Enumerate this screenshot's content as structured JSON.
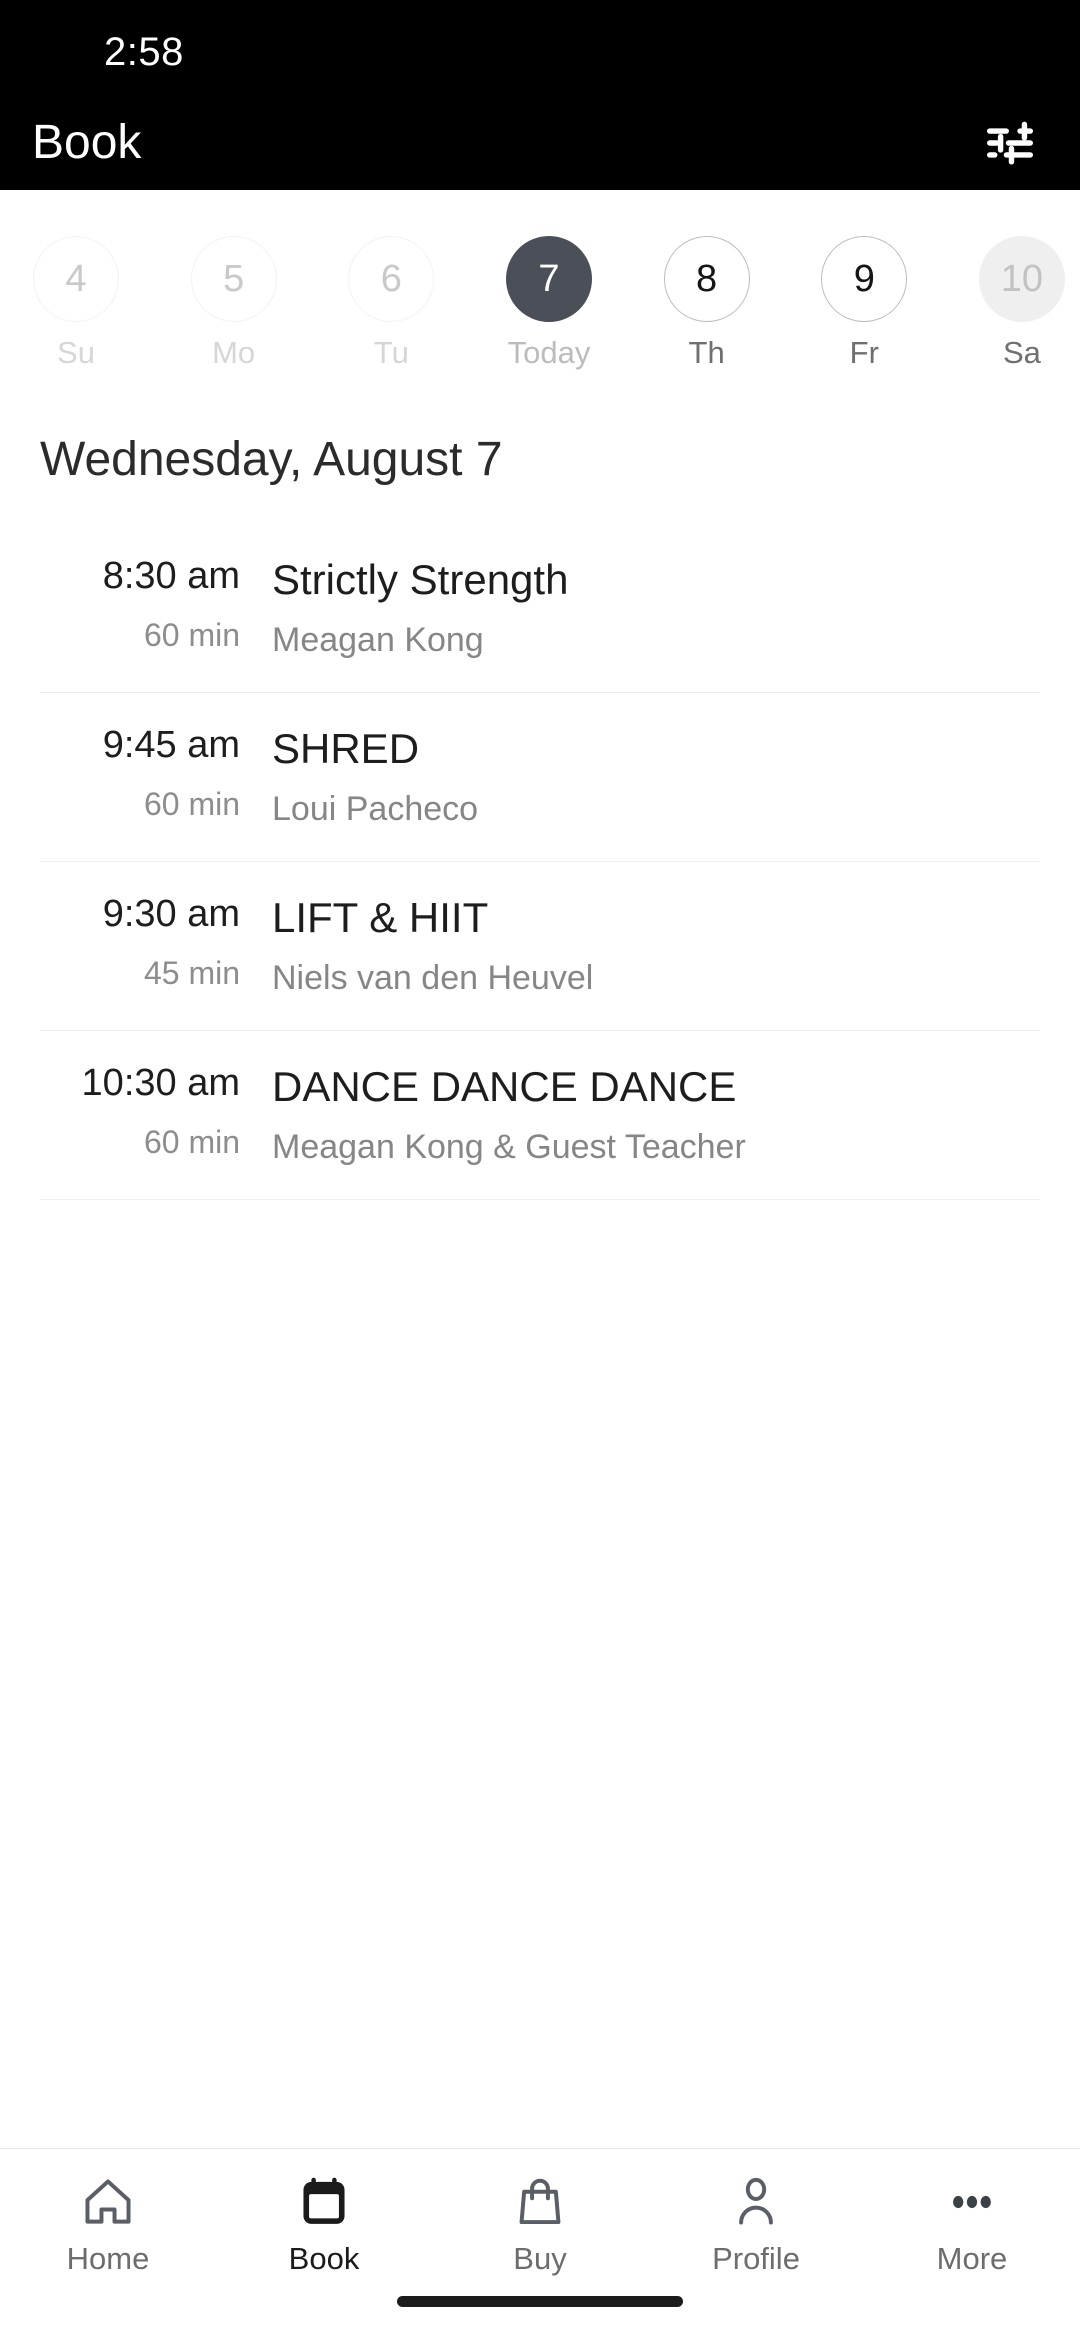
{
  "status_bar": {
    "time": "2:58"
  },
  "app_bar": {
    "title": "Book",
    "filter_icon": "tune-filter-icon"
  },
  "colors": {
    "header_bg": "#000000",
    "selected_day_bg": "#4b4f57",
    "page_bg": "#ffffff",
    "divider": "#eeeeee",
    "muted_text": "#868686"
  },
  "date_strip": {
    "days": [
      {
        "number": "4",
        "label": "Su",
        "state": "past"
      },
      {
        "number": "5",
        "label": "Mo",
        "state": "past"
      },
      {
        "number": "6",
        "label": "Tu",
        "state": "past"
      },
      {
        "number": "7",
        "label": "Today",
        "state": "selected"
      },
      {
        "number": "8",
        "label": "Th",
        "state": "normal"
      },
      {
        "number": "9",
        "label": "Fr",
        "state": "normal"
      },
      {
        "number": "10",
        "label": "Sa",
        "state": "shaded"
      }
    ]
  },
  "schedule": {
    "heading": "Wednesday, August 7",
    "classes": [
      {
        "time": "8:30 am",
        "duration": "60 min",
        "name": "Strictly Strength",
        "instructor": "Meagan Kong"
      },
      {
        "time": "9:45 am",
        "duration": "60 min",
        "name": "SHRED",
        "instructor": "Loui Pacheco"
      },
      {
        "time": "9:30 am",
        "duration": "45 min",
        "name": "LIFT & HIIT",
        "instructor": "Niels van den Heuvel"
      },
      {
        "time": "10:30 am",
        "duration": "60 min",
        "name": "DANCE DANCE DANCE",
        "instructor": "Meagan Kong & Guest Teacher"
      }
    ]
  },
  "bottom_nav": {
    "items": [
      {
        "label": "Home",
        "icon": "home-icon",
        "active": false
      },
      {
        "label": "Book",
        "icon": "calendar-icon",
        "active": true
      },
      {
        "label": "Buy",
        "icon": "shopping-bag-icon",
        "active": false
      },
      {
        "label": "Profile",
        "icon": "person-icon",
        "active": false
      },
      {
        "label": "More",
        "icon": "more-dots-icon",
        "active": false
      }
    ]
  }
}
